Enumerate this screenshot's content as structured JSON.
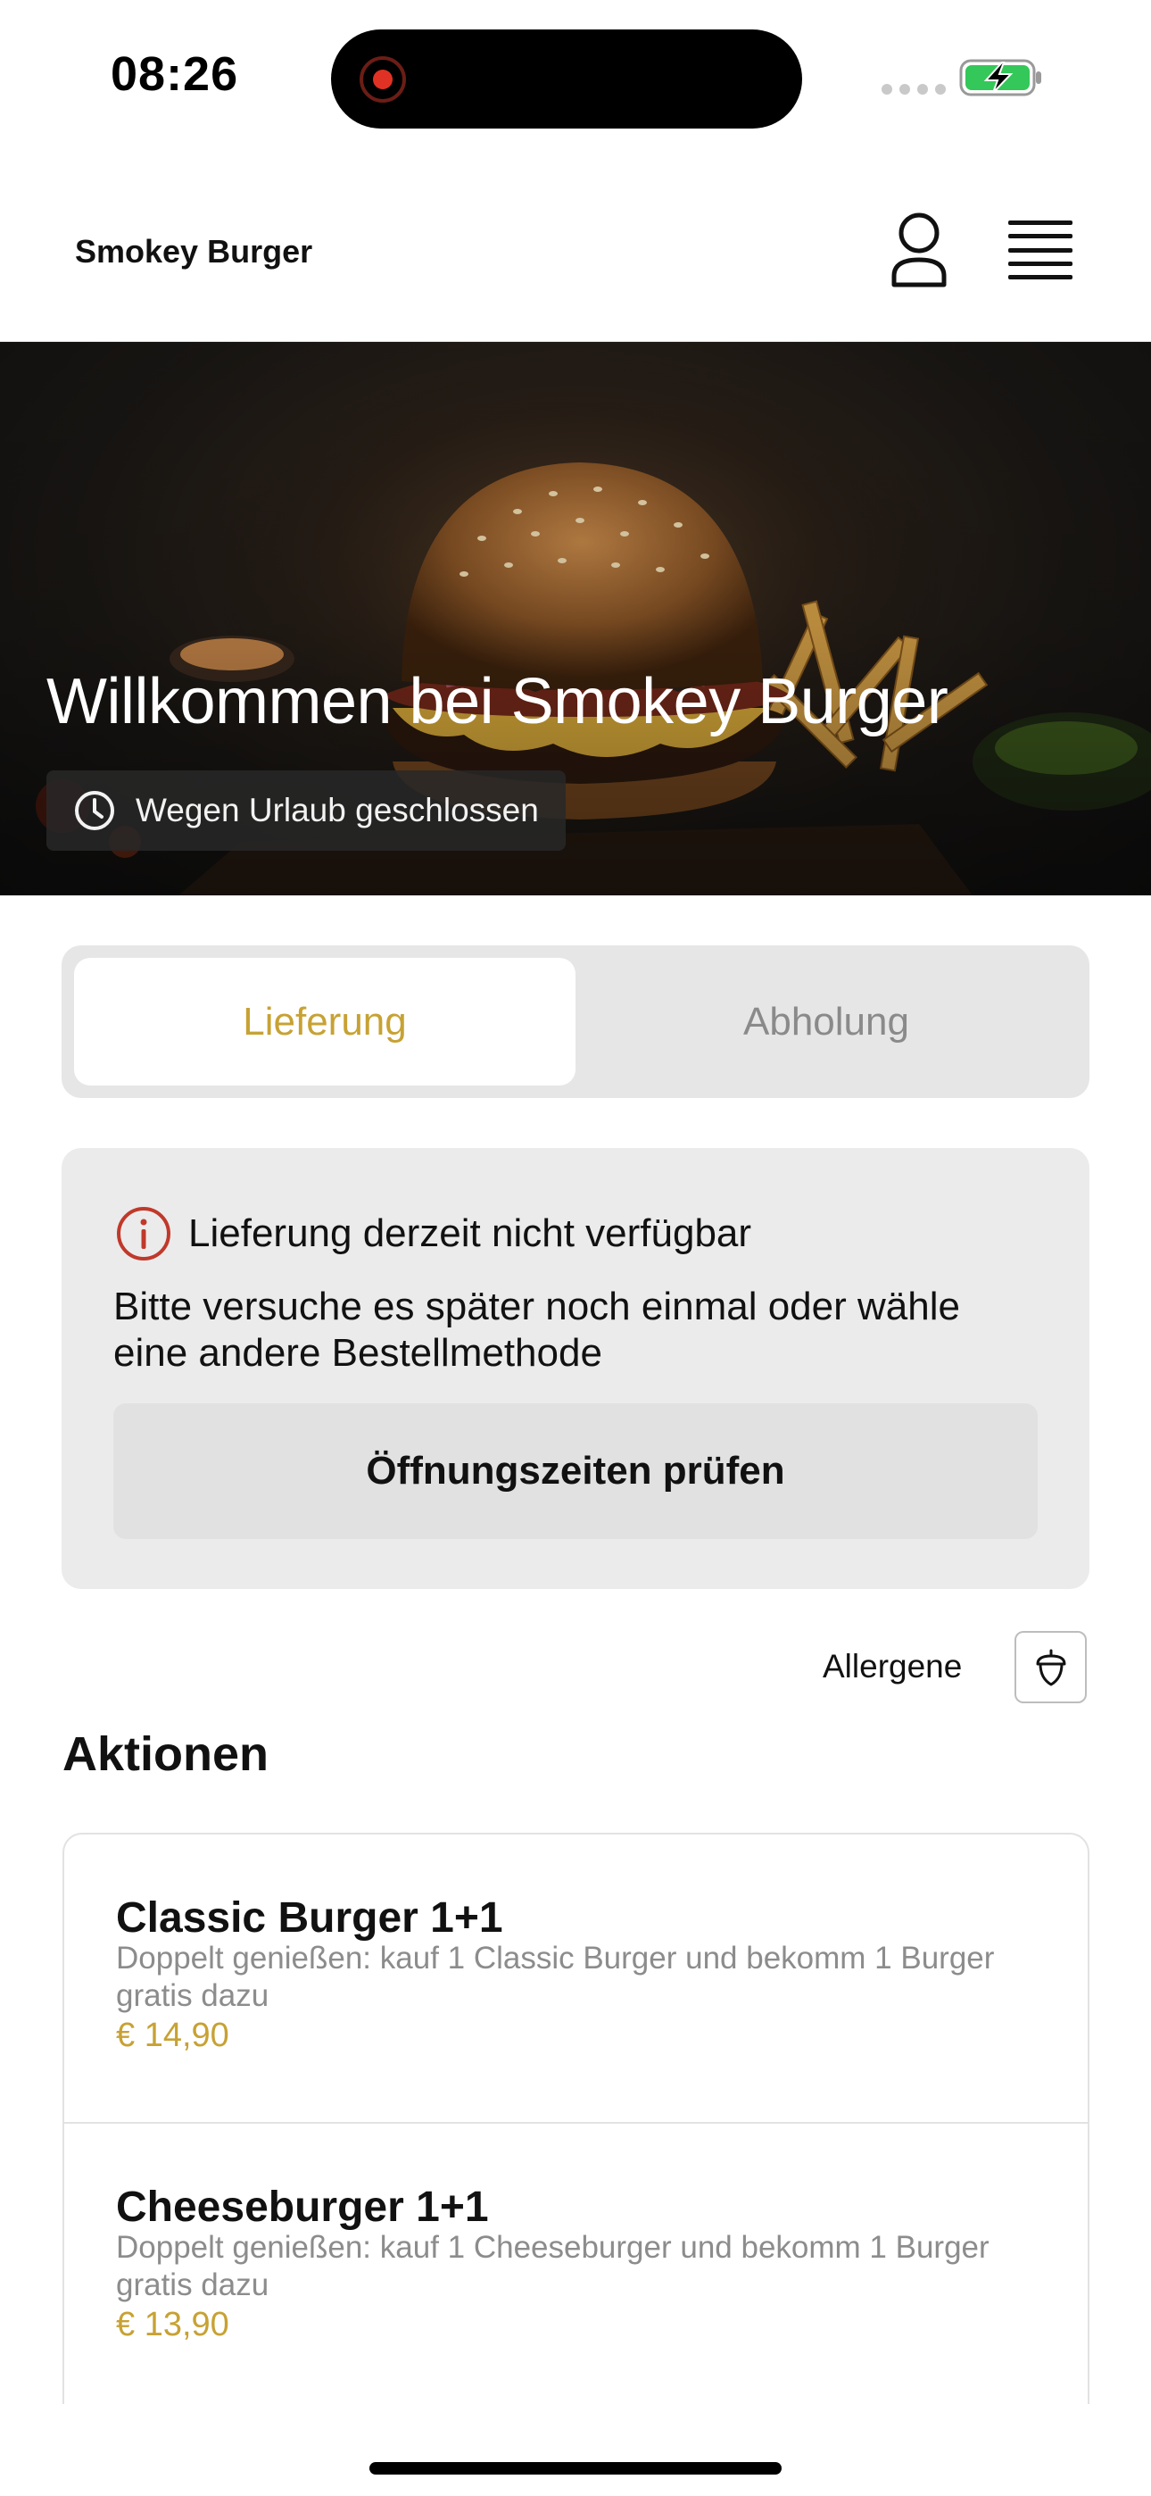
{
  "status_bar": {
    "time": "08:26"
  },
  "header": {
    "brand": "Smokey Burger",
    "profile_icon": "person-icon",
    "menu_icon": "hamburger-menu-icon"
  },
  "hero": {
    "title": "Willkommen bei Smokey Burger",
    "status_chip": "Wegen Urlaub geschlossen",
    "status_icon": "clock-icon"
  },
  "order_mode": {
    "options": [
      "Lieferung",
      "Abholung"
    ],
    "selected": "Lieferung"
  },
  "notice": {
    "icon": "info-icon",
    "title": "Lieferung derzeit nicht verfügbar",
    "body": "Bitte versuche es später noch einmal oder wähle eine andere Bestellmethode",
    "button": "Öffnungszeiten prüfen"
  },
  "allergens": {
    "label": "Allergene",
    "icon": "acorn-icon"
  },
  "section": {
    "title": "Aktionen"
  },
  "products": [
    {
      "name": "Classic Burger 1+1",
      "description": "Doppelt genießen: kauf 1 Classic Burger und bekomm 1 Burger gratis dazu",
      "price": "€ 14,90"
    },
    {
      "name": "Cheeseburger 1+1",
      "description": "Doppelt genießen: kauf 1 Cheeseburger und bekomm 1 Burger gratis dazu",
      "price": "€ 13,90"
    }
  ],
  "colors": {
    "accent": "#c7a234",
    "warning": "#c0392b",
    "battery": "#34c759"
  }
}
